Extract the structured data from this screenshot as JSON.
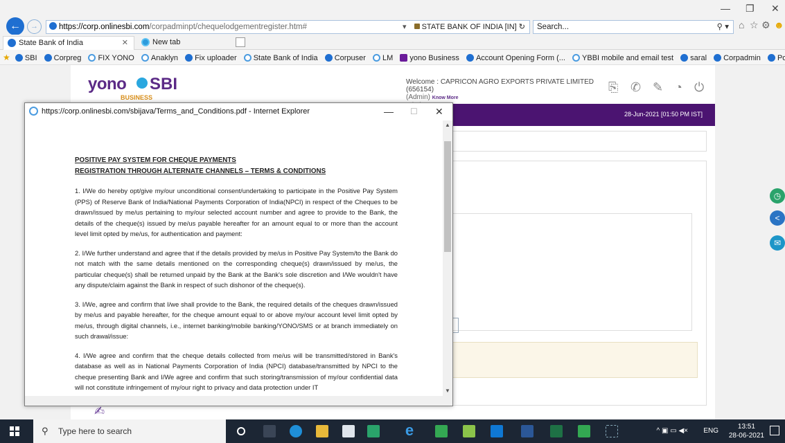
{
  "browser": {
    "url_domain": "https://corp.onlinesbi.com",
    "url_path": "/corpadminpt/chequelodgementregister.htm#",
    "site_identity": "STATE BANK OF INDIA [IN]",
    "search_placeholder": "Search...",
    "tabs": [
      {
        "label": "State Bank of India",
        "active": true
      },
      {
        "label": "New tab",
        "active": false
      }
    ],
    "favorites": [
      "SBI",
      "Corpreg",
      "FIX YONO",
      "Anaklyn",
      "Fix uploader",
      "State Bank of India",
      "Corpuser",
      "LM",
      "yono Business",
      "Account Opening Form (...",
      "YBBI mobile and email test",
      "saral",
      "Corpadmin",
      "Positive pay Saral"
    ]
  },
  "page": {
    "logo_text": "yono",
    "logo_brand": "SBI",
    "logo_sub": "BUSINESS",
    "welcome_text": "Welcome : CAPRICON AGRO EXPORTS PRIVATE LIMITED (656154)",
    "role": "(Admin)",
    "role2": "admin",
    "know_more": "Know More",
    "date_time": "28-Jun-2021 [01:50 PM IST]"
  },
  "popup": {
    "title": "https://corp.onlinesbi.com/sbijava/Terms_and_Conditions.pdf - Internet Explorer",
    "heading1": "POSITIVE PAY SYSTEM FOR CHEQUE PAYMENTS",
    "heading2": "REGISTRATION THROUGH ALTERNATE CHANNELS – TERMS & CONDITIONS",
    "para1": "1. I/We do hereby opt/give my/our unconditional consent/undertaking to participate in the Positive Pay System (PPS) of Reserve Bank of India/National Payments Corporation of India(NPCI) in respect of the Cheques to be drawn/issued by me/us pertaining to my/our selected account number and agree to provide to the Bank, the details of the cheque(s) issued by me/us payable hereafter for an amount equal to or more than the account level limit opted by me/us, for authentication and payment:",
    "para2": "2. I/We further understand and agree that if the details provided by me/us in Positive Pay System/to the Bank do not match with the same details mentioned on the corresponding cheque(s) drawn/issued by me/us, the particular cheque(s) shall be returned unpaid by the Bank at the Bank's sole discretion and I/We wouldn't have any dispute/claim against the Bank in respect of such dishonor of the cheque(s).",
    "para3": "3. I/We, agree and confirm that I/we shall provide to the Bank, the required details of the cheques drawn/issued by me/us and payable hereafter, for the cheque amount equal to or above my/our account level limit opted by me/us, through digital channels, i.e., internet banking/mobile banking/YONO/SMS or at branch immediately on such drawal/issue:",
    "para4": "4. I/We agree and confirm that the cheque details collected from me/us will be transmitted/stored in Bank's database as well as in National Payments Corporation of India (NPCI) database/transmitted by NPCI to the cheque presenting Bank and I/We agree and confirm that such storing/transmission of my/our confidential data will not constitute infringement of my/our right to privacy and data protection under IT"
  },
  "taskbar": {
    "search_placeholder": "Type here to search",
    "language": "ENG",
    "time": "13:51",
    "date": "28-06-2021"
  }
}
